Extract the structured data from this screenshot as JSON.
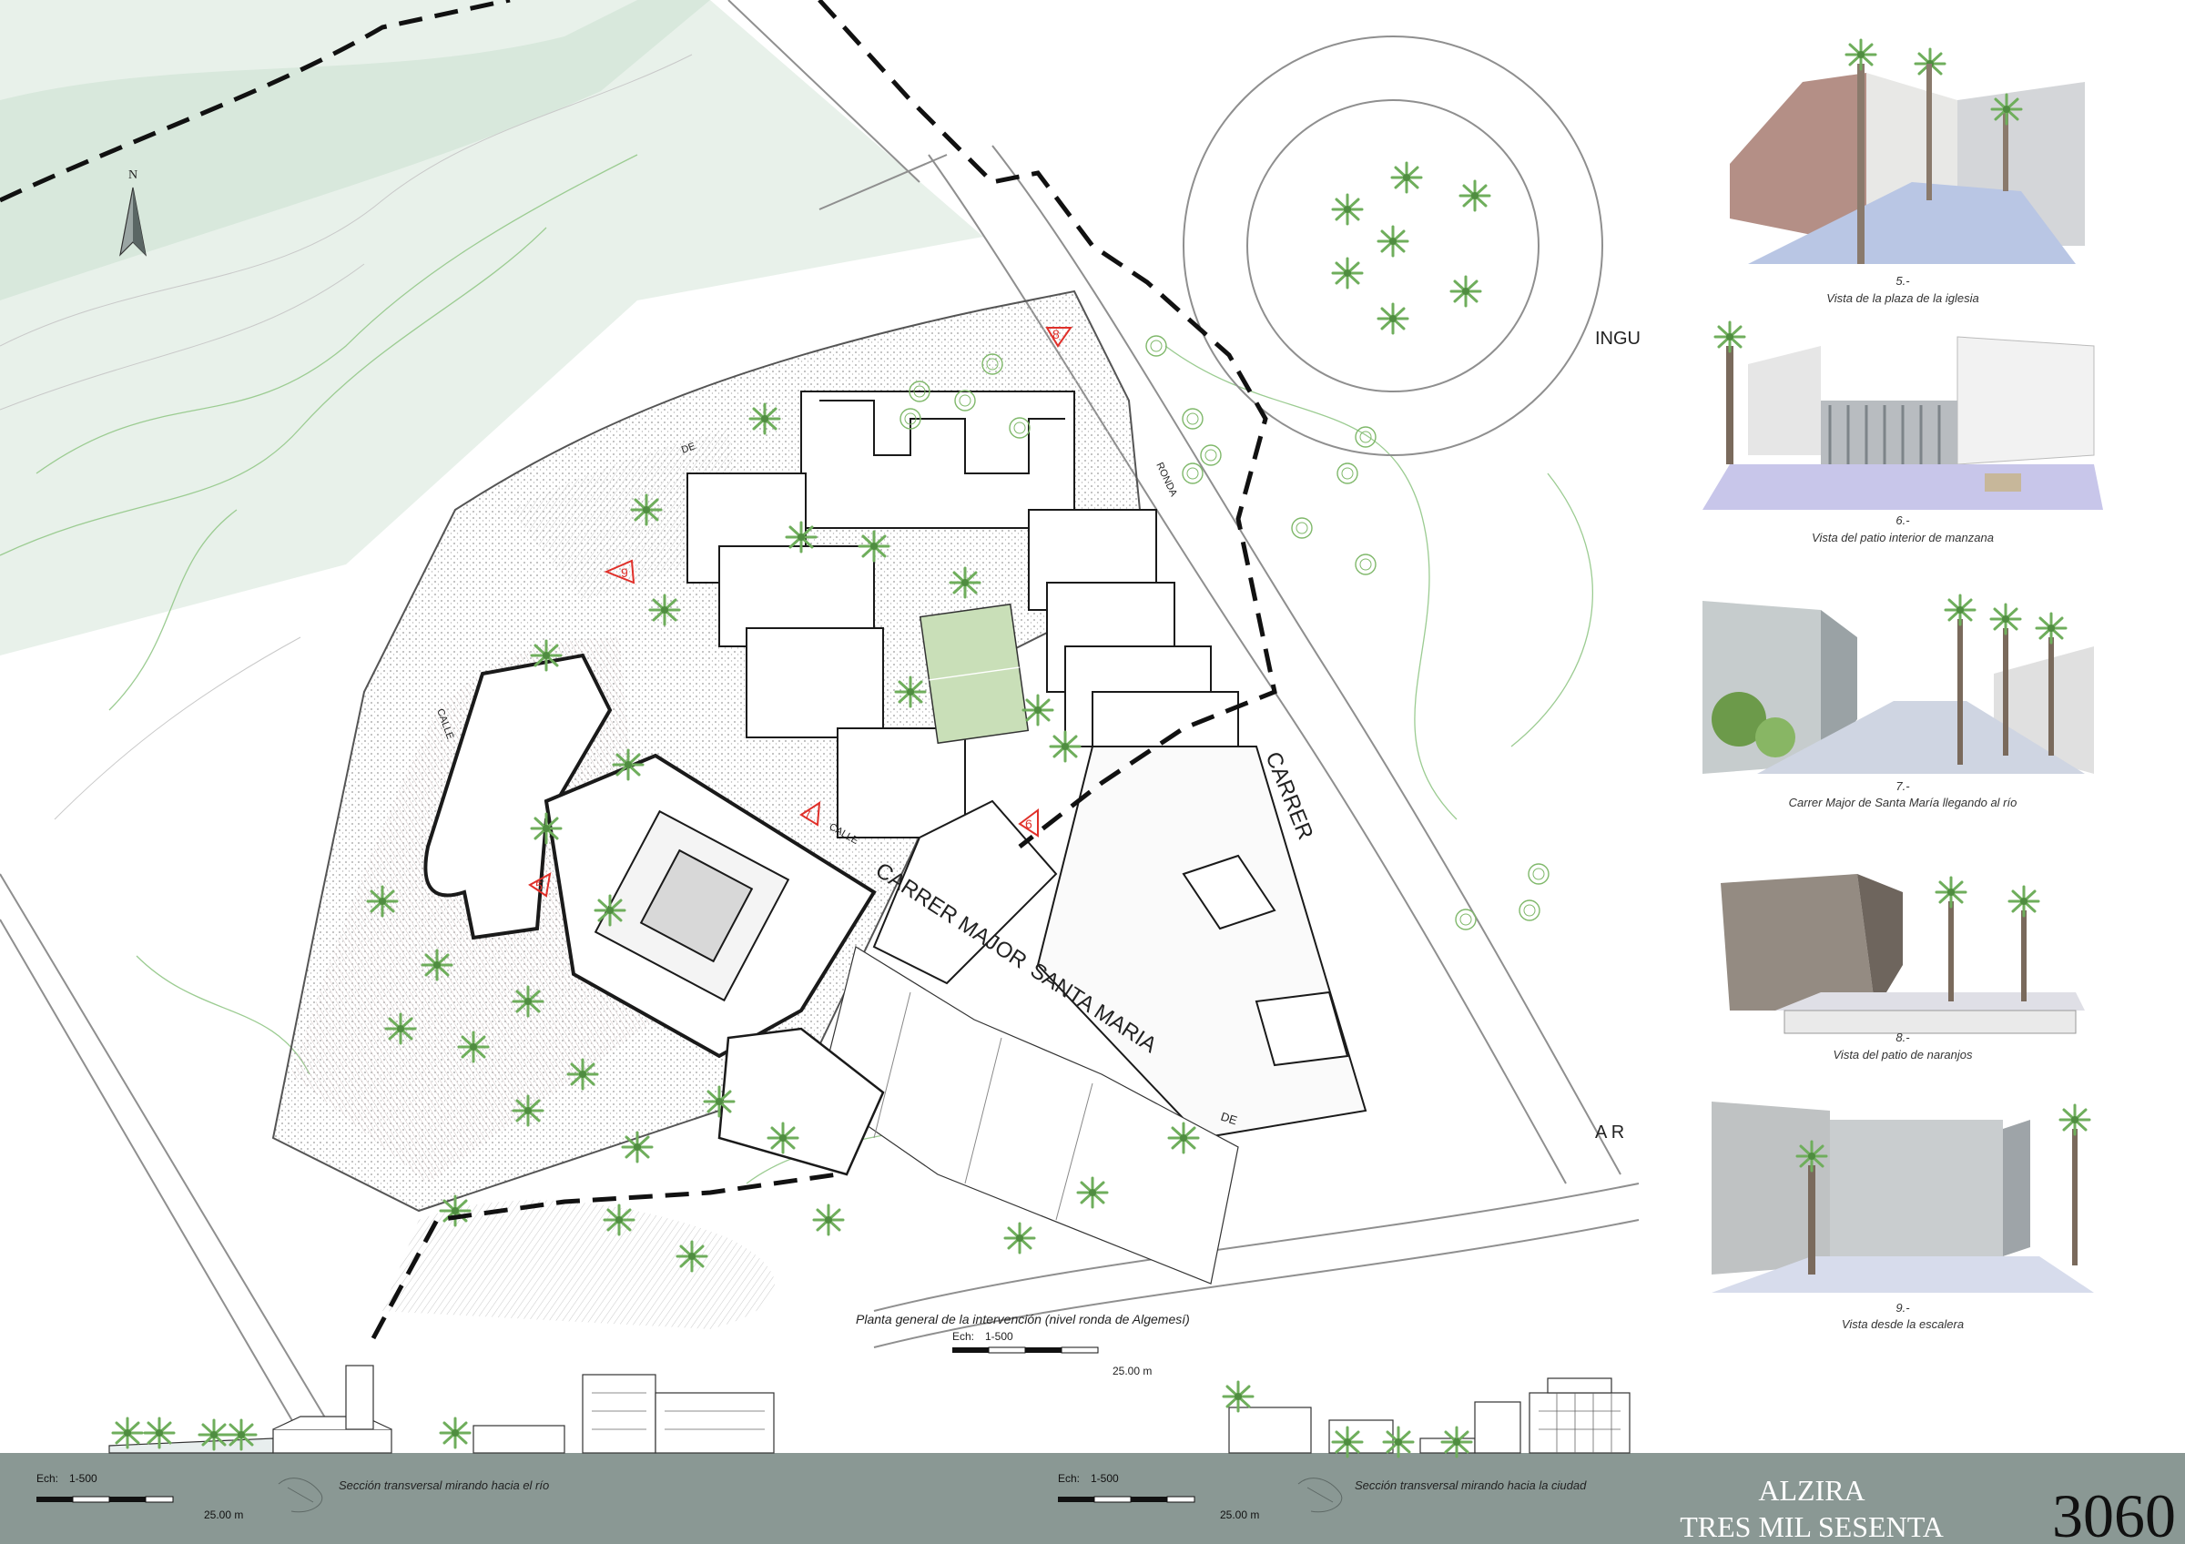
{
  "plan": {
    "north_label": "N",
    "title": "Planta general de la intervención (nivel ronda de Algemesí)",
    "scale_label": "Ech:",
    "scale_ratio": "1-500",
    "scale_distance": "25.00 m",
    "viewpoints": [
      "5",
      "6",
      "7",
      "8",
      "9"
    ]
  },
  "streets": {
    "carrer_major": "CARRER MAJOR",
    "santa_maria": "SANTA MARIA",
    "de_main": "DE",
    "carrer_right": "CARRER",
    "ronda": "RONDA",
    "calle_left": "CALLE",
    "calle_mid": "CALLE",
    "de_top": "DE",
    "ingu_partial": "INGU",
    "a_r_partial": "A R"
  },
  "views": [
    {
      "number": "5.-",
      "caption": "Vista de la plaza de la iglesia"
    },
    {
      "number": "6.-",
      "caption": "Vista del patio interior de manzana"
    },
    {
      "number": "7.-",
      "caption": "Carrer Major de Santa María llegando al río"
    },
    {
      "number": "8.-",
      "caption": "Vista del patio de naranjos"
    },
    {
      "number": "9.-",
      "caption": "Vista desde la escalera"
    }
  ],
  "sections": [
    {
      "scale_label": "Ech:",
      "scale_ratio": "1-500",
      "scale_distance": "25.00 m",
      "caption": "Sección transversal mirando hacia el río"
    },
    {
      "scale_label": "Ech:",
      "scale_ratio": "1-500",
      "scale_distance": "25.00 m",
      "caption": "Sección transversal mirando hacia la ciudad"
    }
  ],
  "branding": {
    "line1": "ALZIRA",
    "line2": "TRES MIL SESENTA",
    "number": "3060"
  },
  "colors": {
    "footer_band": "#8a9894",
    "river_green": "#dfece2",
    "contour_green": "#8fbf84",
    "tree_green": "#7fb86a",
    "marker_red": "#e0302a"
  }
}
